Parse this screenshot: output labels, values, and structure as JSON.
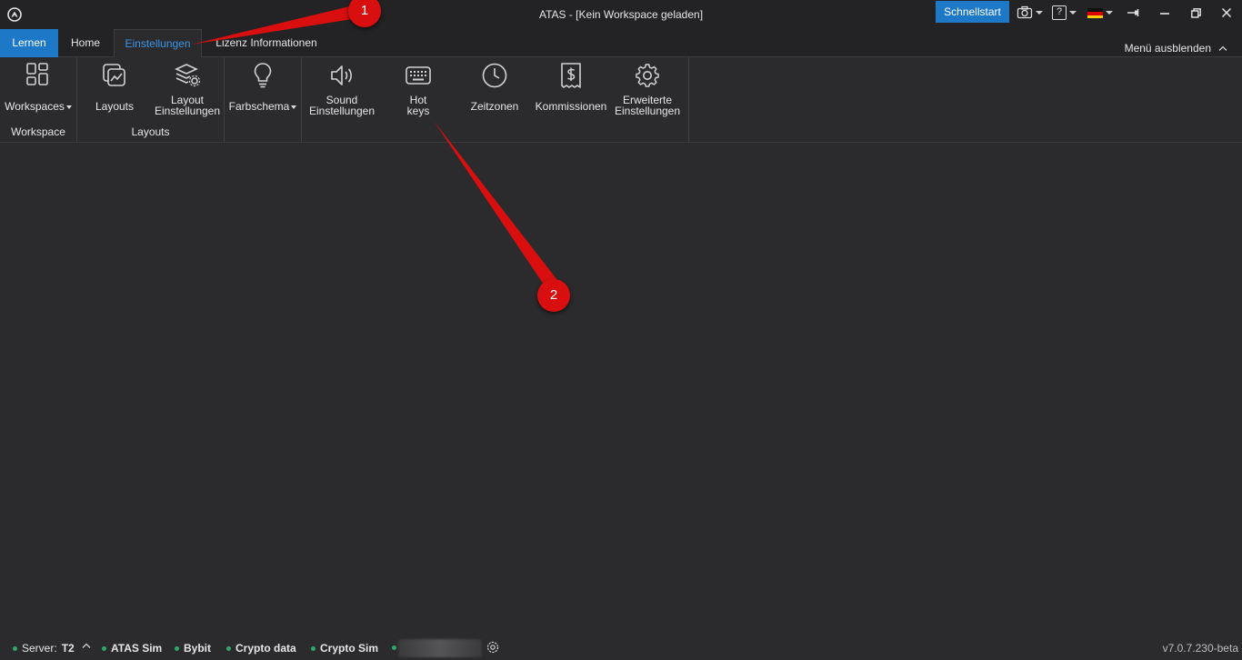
{
  "window": {
    "title": "ATAS - [Kein Workspace geladen]"
  },
  "titlebar": {
    "quick_start": "Schnellstart",
    "help_label": "?",
    "icons": [
      "app-logo-icon",
      "camera-icon",
      "help-icon",
      "german-flag-icon",
      "pin-icon",
      "minimize-icon",
      "restore-icon",
      "close-icon"
    ]
  },
  "tabs": {
    "learn": "Lernen",
    "home": "Home",
    "settings": "Einstellungen",
    "license": "Lizenz Informationen",
    "menu_hide": "Menü ausblenden"
  },
  "ribbon": {
    "workspace_group": {
      "label": "Workspace",
      "workspaces": "Workspaces"
    },
    "layouts_group": {
      "label": "Layouts",
      "layouts": "Layouts",
      "layout_settings_1": "Layout",
      "layout_settings_2": "Einstellungen"
    },
    "color_group": {
      "color_scheme": "Farbschema"
    },
    "settings_group": {
      "sound_1": "Sound",
      "sound_2": "Einstellungen",
      "hotkeys_1": "Hot",
      "hotkeys_2": "keys",
      "timezones": "Zeitzonen",
      "commissions": "Kommissionen",
      "advanced_1": "Erweiterte",
      "advanced_2": "Einstellungen"
    }
  },
  "statusbar": {
    "server_label": "Server:",
    "server_value": "T2",
    "connections": [
      "ATAS Sim",
      "Bybit",
      "Crypto data",
      "Crypto Sim"
    ],
    "status_color": "#2fa86a",
    "version": "v7.0.7.230-beta"
  },
  "annotations": {
    "marker_1": "1",
    "marker_2": "2",
    "color": "#d90f0f"
  },
  "colors": {
    "accent": "#1e78c8",
    "active_tab": "#3a95e6",
    "background": "#2b2b2d",
    "titlebar": "#232325"
  }
}
